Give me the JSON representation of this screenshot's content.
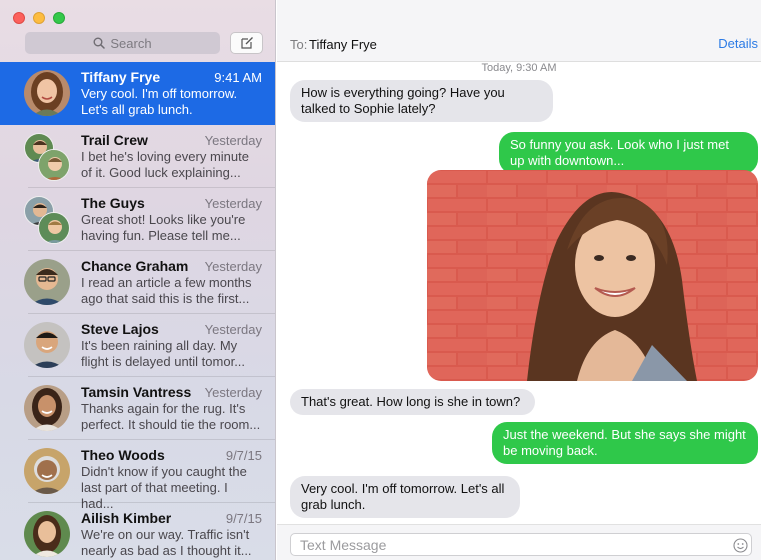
{
  "window": {
    "traffic_lights": [
      "close",
      "minimize",
      "zoom"
    ]
  },
  "sidebar": {
    "search_placeholder": "Search",
    "compose_icon": "compose-icon",
    "conversations": [
      {
        "name": "Tiffany Frye",
        "time": "9:41 AM",
        "preview": "Very cool. I'm off tomorrow. Let's all grab lunch.",
        "selected": true
      },
      {
        "name": "Trail Crew",
        "time": "Yesterday",
        "preview": "I bet he's loving every minute of it. Good luck explaining..."
      },
      {
        "name": "The Guys",
        "time": "Yesterday",
        "preview": "Great shot! Looks like you're having fun. Please tell me..."
      },
      {
        "name": "Chance Graham",
        "time": "Yesterday",
        "preview": "I read an article a few months ago that said this is the first..."
      },
      {
        "name": "Steve Lajos",
        "time": "Yesterday",
        "preview": "It's been raining all day. My flight is delayed until tomor..."
      },
      {
        "name": "Tamsin Vantress",
        "time": "Yesterday",
        "preview": "Thanks again for the rug. It's perfect. It should tie the room..."
      },
      {
        "name": "Theo Woods",
        "time": "9/7/15",
        "preview": "Didn't know if you caught the last part of that meeting. I had..."
      },
      {
        "name": "Ailish Kimber",
        "time": "9/7/15",
        "preview": "We're on our way. Traffic isn't nearly as bad as I thought it..."
      }
    ]
  },
  "header": {
    "to_label": "To:",
    "recipient": "Tiffany Frye",
    "details_label": "Details"
  },
  "transcript": {
    "timestamp": "Today, 9:30 AM",
    "messages": [
      {
        "direction": "in",
        "text": "How is everything going? Have you talked to Sophie lately?"
      },
      {
        "direction": "out",
        "text": "So funny you ask. Look who I just met up with downtown..."
      },
      {
        "direction": "out",
        "type": "photo"
      },
      {
        "direction": "in",
        "text": "That's great. How long is she in town?"
      },
      {
        "direction": "out",
        "text": "Just the weekend. But she says she might be moving back."
      },
      {
        "direction": "in",
        "text": "Very cool. I'm off tomorrow. Let's all grab lunch."
      }
    ]
  },
  "composer": {
    "placeholder": "Text Message",
    "emoji_icon": "emoji-icon"
  },
  "colors": {
    "selection_blue": "#1d6ae5",
    "outgoing_green": "#2fc84a",
    "incoming_gray": "#e5e5ea",
    "link_blue": "#2c7be5"
  }
}
